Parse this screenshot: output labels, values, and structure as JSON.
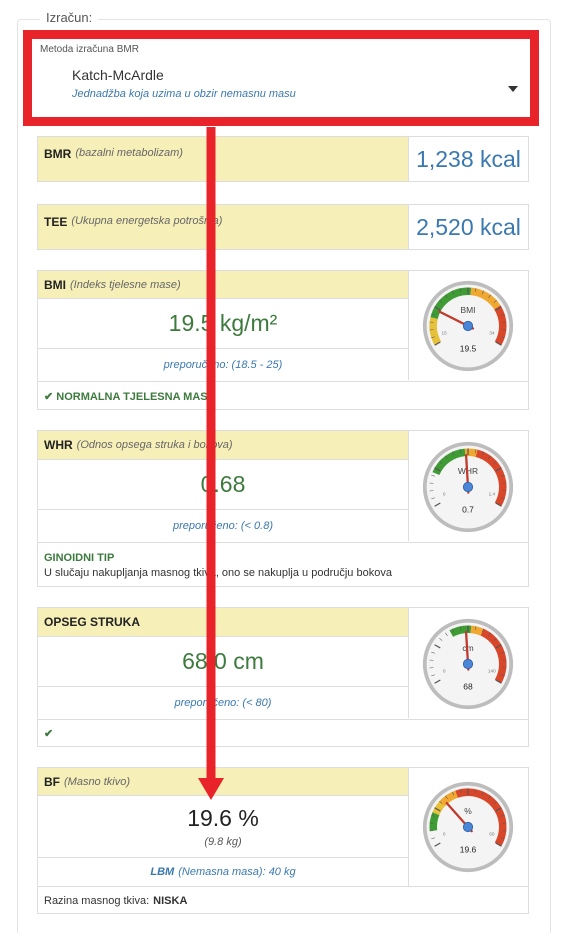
{
  "legend": "Izračun:",
  "bmr_method": {
    "label": "Metoda izračuna BMR",
    "value": "Katch-McArdle",
    "description": "Jednadžba koja uzima u obzir nemasnu masu"
  },
  "bmr": {
    "title": "BMR",
    "subtitle": "(bazalni metabolizam)",
    "value": "1,238 kcal"
  },
  "tee": {
    "title": "TEE",
    "subtitle": "(Ukupna energetska potrošnja)",
    "value": "2,520 kcal"
  },
  "bmi": {
    "title": "BMI",
    "subtitle": "(Indeks tjelesne mase)",
    "value": "19.5 kg/m²",
    "recommended": "preporučeno: (18.5 - 25)",
    "status": "✔ NORMALNA TJELESNA MASA",
    "gauge": {
      "label": "BMI",
      "reading": "19.5",
      "min_label": "15",
      "max_label": "34",
      "min": 15,
      "max": 34,
      "value": 19.5
    }
  },
  "whr": {
    "title": "WHR",
    "subtitle": "(Odnos opsega struka i bokova)",
    "value": "0.68",
    "recommended": "preporučeno: (< 0.8)",
    "type_title": "GINOIDNI TIP",
    "type_desc": "U slučaju nakupljanja masnog tkiva, ono se nakuplja u području bokova",
    "gauge": {
      "label": "WHR",
      "reading": "0.7",
      "min_label": "0",
      "max_label": "1.4",
      "min": 0,
      "max": 1.4,
      "value": 0.68
    }
  },
  "waist": {
    "title": "OPSEG STRUKA",
    "value": "68.0 cm",
    "recommended": "preporučeno: (< 80)",
    "status": "✔",
    "gauge": {
      "label": "cm",
      "reading": "68",
      "min_label": "0",
      "max_label": "140",
      "min": 0,
      "max": 140,
      "value": 68
    }
  },
  "bf": {
    "title": "BF",
    "subtitle": "(Masno tkivo)",
    "value": "19.6 %",
    "mass": "(9.8 kg)",
    "lbm_label": "LBM",
    "lbm_text": "(Nemasna masa): 40 kg",
    "level_label": "Razina masnog tkiva:",
    "level_value": "NISKA",
    "gauge": {
      "label": "%",
      "reading": "19.6",
      "min_label": "0",
      "max_label": "60",
      "min": 0,
      "max": 60,
      "value": 19.6
    }
  },
  "colors": {
    "accent": "#3a78b0",
    "highlight": "#e8232a",
    "header_bg": "#f6efb8",
    "ok": "#3d7a3d"
  }
}
